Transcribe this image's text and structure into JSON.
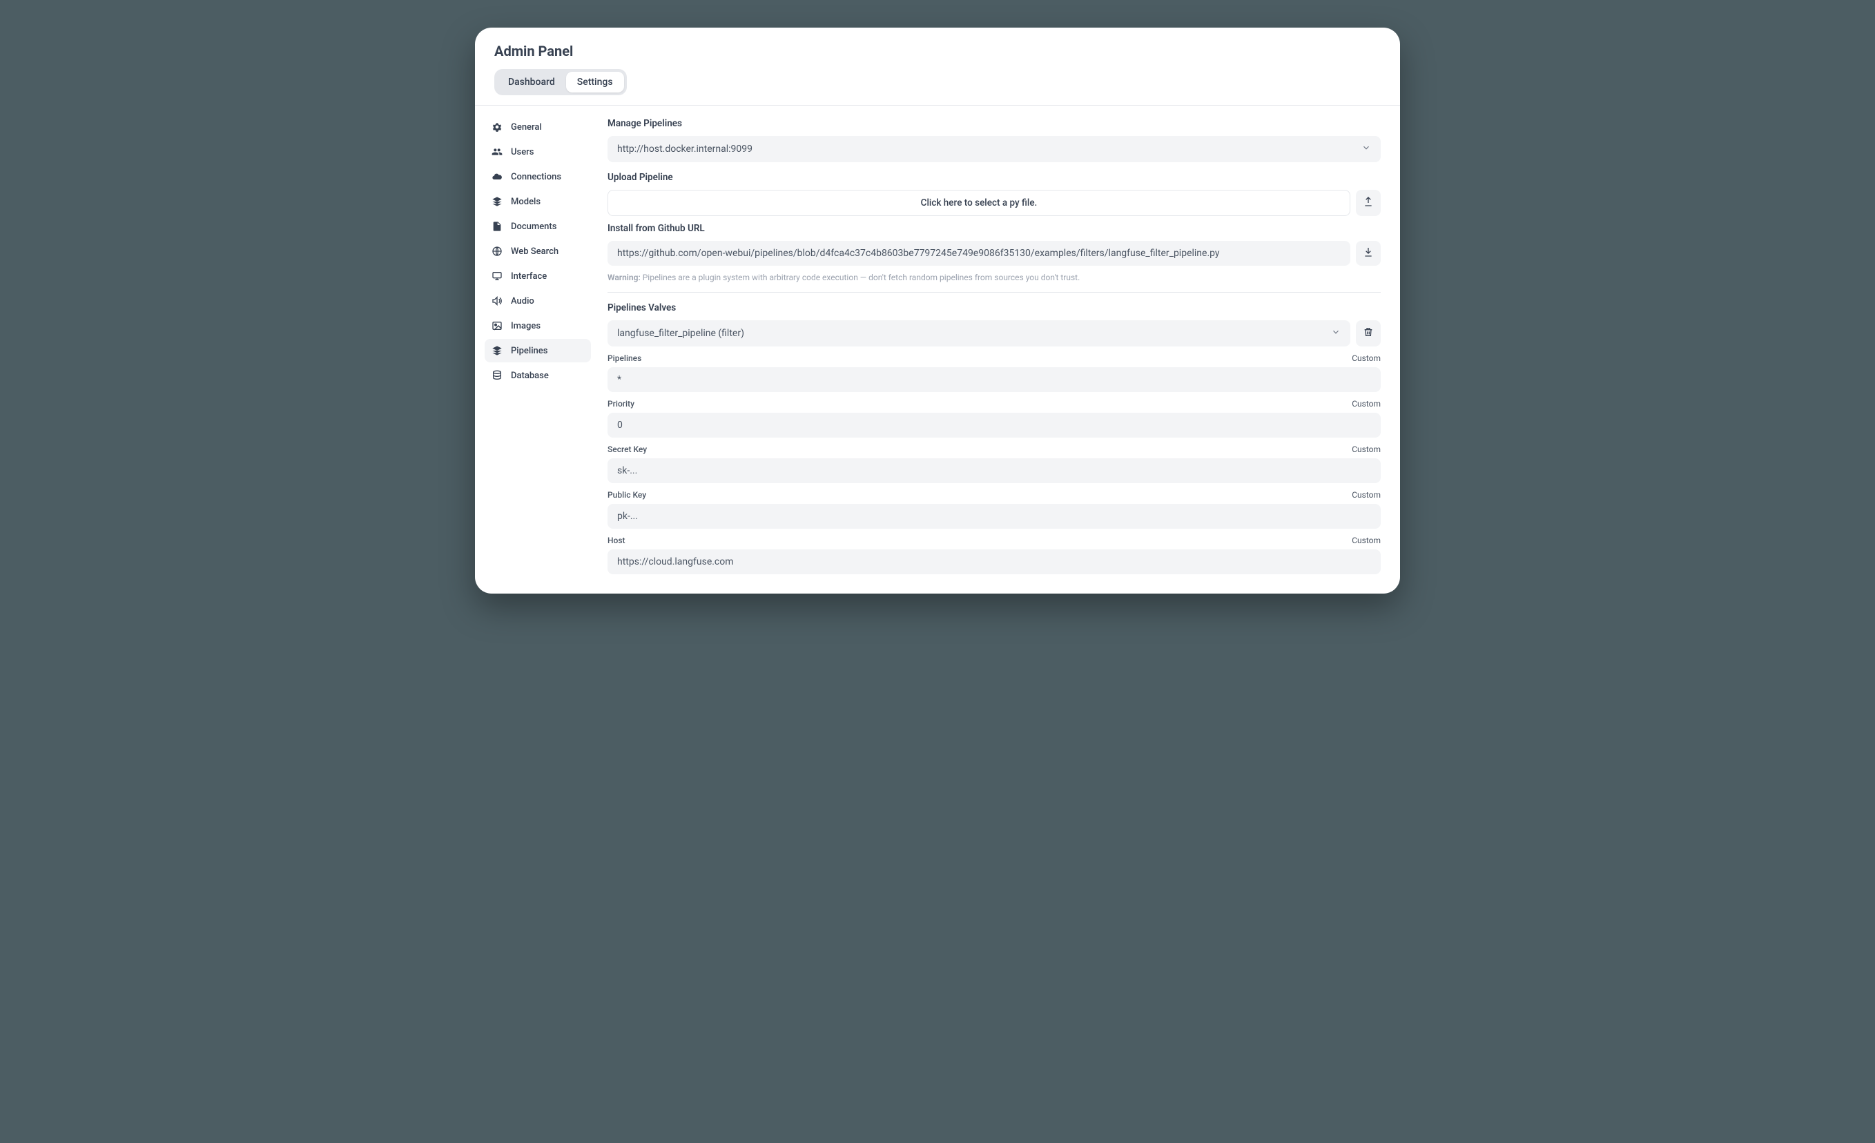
{
  "header": {
    "title": "Admin Panel",
    "tabs": {
      "dashboard": "Dashboard",
      "settings": "Settings"
    }
  },
  "sidebar": {
    "items": [
      {
        "label": "General"
      },
      {
        "label": "Users"
      },
      {
        "label": "Connections"
      },
      {
        "label": "Models"
      },
      {
        "label": "Documents"
      },
      {
        "label": "Web Search"
      },
      {
        "label": "Interface"
      },
      {
        "label": "Audio"
      },
      {
        "label": "Images"
      },
      {
        "label": "Pipelines"
      },
      {
        "label": "Database"
      }
    ]
  },
  "main": {
    "manage_label": "Manage Pipelines",
    "host_value": "http://host.docker.internal:9099",
    "upload_label": "Upload Pipeline",
    "upload_prompt": "Click here to select a py file.",
    "install_label": "Install from Github URL",
    "install_value": "https://github.com/open-webui/pipelines/blob/d4fca4c37c4b8603be7797245e749e9086f35130/examples/filters/langfuse_filter_pipeline.py",
    "warning_bold": "Warning:",
    "warning_text": " Pipelines are a plugin system with arbitrary code execution — don't fetch random pipelines from sources you don't trust.",
    "valves_label": "Pipelines Valves",
    "selected_pipeline": "langfuse_filter_pipeline (filter)",
    "custom_label": "Custom",
    "fields": {
      "pipelines": {
        "label": "Pipelines",
        "value": "*"
      },
      "priority": {
        "label": "Priority",
        "value": "0"
      },
      "secret": {
        "label": "Secret Key",
        "value": "sk-..."
      },
      "public": {
        "label": "Public Key",
        "value": "pk-..."
      },
      "host": {
        "label": "Host",
        "value": "https://cloud.langfuse.com"
      }
    }
  }
}
